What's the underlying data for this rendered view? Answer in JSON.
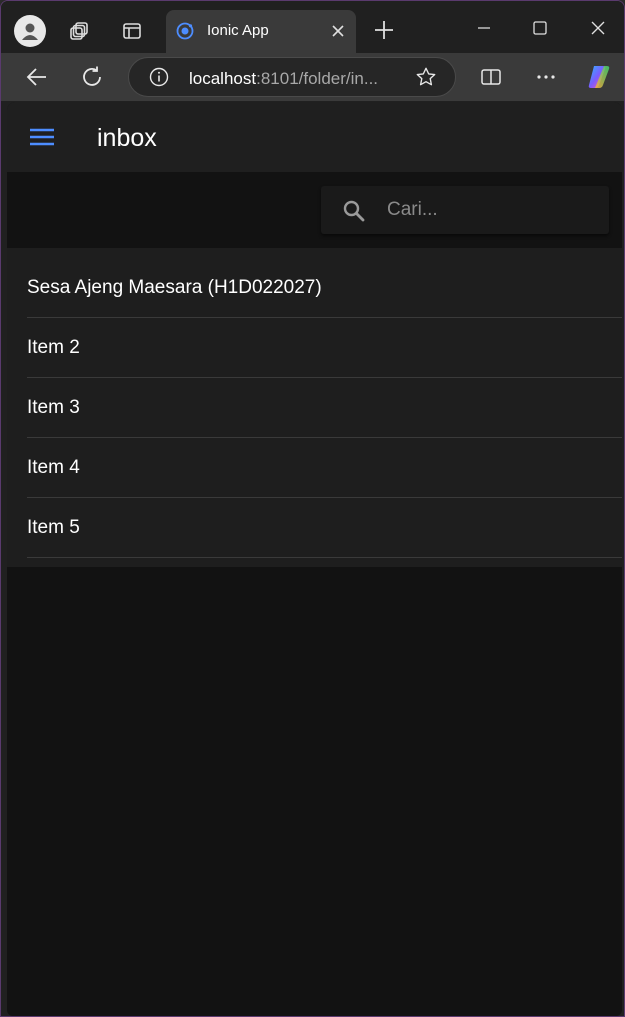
{
  "browser": {
    "tab_title": "Ionic App",
    "url_host": "localhost",
    "url_path": ":8101/folder/in..."
  },
  "app": {
    "title": "inbox",
    "search_placeholder": "Cari...",
    "items": [
      "Sesa Ajeng Maesara (H1D022027)",
      "Item 2",
      "Item 3",
      "Item 4",
      "Item 5"
    ]
  },
  "colors": {
    "accent": "#4d8dff",
    "background": "#121212",
    "list_background": "#1e1e1e"
  },
  "icons": {
    "menu": "menu-icon",
    "search": "search-icon"
  }
}
